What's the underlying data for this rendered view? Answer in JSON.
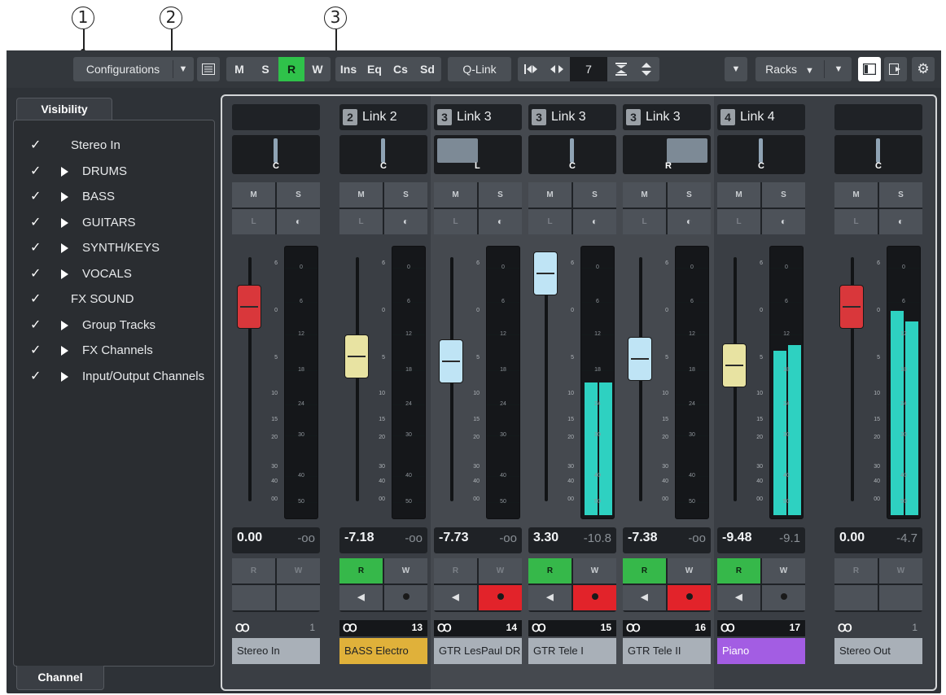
{
  "callouts": [
    "1",
    "2",
    "3"
  ],
  "toolbar": {
    "configurations_label": "Configurations",
    "dropdown_arrow": "▼",
    "list_icon": "list-icon",
    "mode_buttons": [
      "M",
      "S",
      "R",
      "W"
    ],
    "section_buttons": [
      "Ins",
      "Eq",
      "Cs",
      "Sd"
    ],
    "qlink_label": "Q-Link",
    "channel_count": "7",
    "racks_label": "Racks",
    "accent_green": "#2fc24a"
  },
  "visibility": {
    "tab_label": "Visibility",
    "bottom_tab_label": "Channel",
    "items": [
      {
        "check": "✓",
        "expandable": false,
        "label": "Stereo In"
      },
      {
        "check": "✓",
        "expandable": true,
        "label": "DRUMS"
      },
      {
        "check": "✓",
        "expandable": true,
        "label": "BASS"
      },
      {
        "check": "✓",
        "expandable": true,
        "label": "GUITARS"
      },
      {
        "check": "✓",
        "expandable": true,
        "label": "SYNTH/KEYS"
      },
      {
        "check": "✓",
        "expandable": true,
        "label": "VOCALS"
      },
      {
        "check": "✓",
        "expandable": false,
        "label": "FX SOUND"
      },
      {
        "check": "✓",
        "expandable": true,
        "label": "Group Tracks"
      },
      {
        "check": "✓",
        "expandable": true,
        "label": "FX Channels"
      },
      {
        "check": "✓",
        "expandable": true,
        "label": "Input/Output Channels"
      }
    ]
  },
  "fader_scale": [
    "6",
    "0",
    "5",
    "10",
    "15",
    "20",
    "30",
    "40",
    "00"
  ],
  "meter_scale": [
    "0",
    "6",
    "12",
    "18",
    "24",
    "30",
    "40",
    "50"
  ],
  "button_labels": {
    "mute": "M",
    "solo": "S",
    "listen": "L",
    "read": "R",
    "write": "W"
  },
  "channels": [
    {
      "link_num": "",
      "link_label": "",
      "pan": "C",
      "pan_value": 0,
      "volume": "0.00",
      "peak": "-oo",
      "number": "1",
      "name": "Stereo In",
      "name_color": "#a9b0b8",
      "read_active": false,
      "rec_active": false,
      "fader_color": "#d9373b",
      "fader_level": 0.79,
      "meter_left": 0,
      "meter_right": 0,
      "highlight": false
    },
    {
      "link_num": "2",
      "link_label": "Link 2",
      "pan": "C",
      "pan_value": 0,
      "volume": "-7.18",
      "peak": "-oo",
      "number": "13",
      "name": "BASS Electro",
      "name_color": "#e0b13a",
      "read_active": true,
      "rec_active": false,
      "fader_color": "#e8e3a2",
      "fader_level": 0.58,
      "meter_left": 0,
      "meter_right": 0,
      "highlight": false
    },
    {
      "link_num": "3",
      "link_label": "Link 3",
      "pan": "L",
      "pan_value": -1,
      "volume": "-7.73",
      "peak": "-oo",
      "number": "14",
      "name": "GTR LesPaul DR",
      "name_color": "#a9b0b8",
      "read_active": false,
      "rec_active": true,
      "fader_color": "#bfe4f5",
      "fader_level": 0.56,
      "meter_left": 0,
      "meter_right": 0,
      "highlight": true
    },
    {
      "link_num": "3",
      "link_label": "Link 3",
      "pan": "C",
      "pan_value": 0,
      "volume": "3.30",
      "peak": "-10.8",
      "number": "15",
      "name": "GTR Tele I",
      "name_color": "#a9b0b8",
      "read_active": true,
      "rec_active": true,
      "fader_color": "#bfe4f5",
      "fader_level": 0.93,
      "meter_left": 0.5,
      "meter_right": 0.5,
      "highlight": true
    },
    {
      "link_num": "3",
      "link_label": "Link 3",
      "pan": "R",
      "pan_value": 1,
      "volume": "-7.38",
      "peak": "-oo",
      "number": "16",
      "name": "GTR Tele II",
      "name_color": "#a9b0b8",
      "read_active": true,
      "rec_active": true,
      "fader_color": "#bfe4f5",
      "fader_level": 0.57,
      "meter_left": 0,
      "meter_right": 0,
      "highlight": true
    },
    {
      "link_num": "4",
      "link_label": "Link 4",
      "pan": "C",
      "pan_value": 0,
      "volume": "-9.48",
      "peak": "-9.1",
      "number": "17",
      "name": "Piano",
      "name_color": "#a35de3",
      "read_active": true,
      "rec_active": false,
      "fader_color": "#e8e3a2",
      "fader_level": 0.54,
      "meter_left": 0.62,
      "meter_right": 0.64,
      "highlight": false
    },
    {
      "link_num": "",
      "link_label": "",
      "pan": "C",
      "pan_value": 0,
      "volume": "0.00",
      "peak": "-4.7",
      "number": "1",
      "name": "Stereo Out",
      "name_color": "#a9b0b8",
      "read_active": false,
      "rec_active": false,
      "fader_color": "#d9373b",
      "fader_level": 0.79,
      "meter_left": 0.77,
      "meter_right": 0.73,
      "highlight": false
    }
  ]
}
